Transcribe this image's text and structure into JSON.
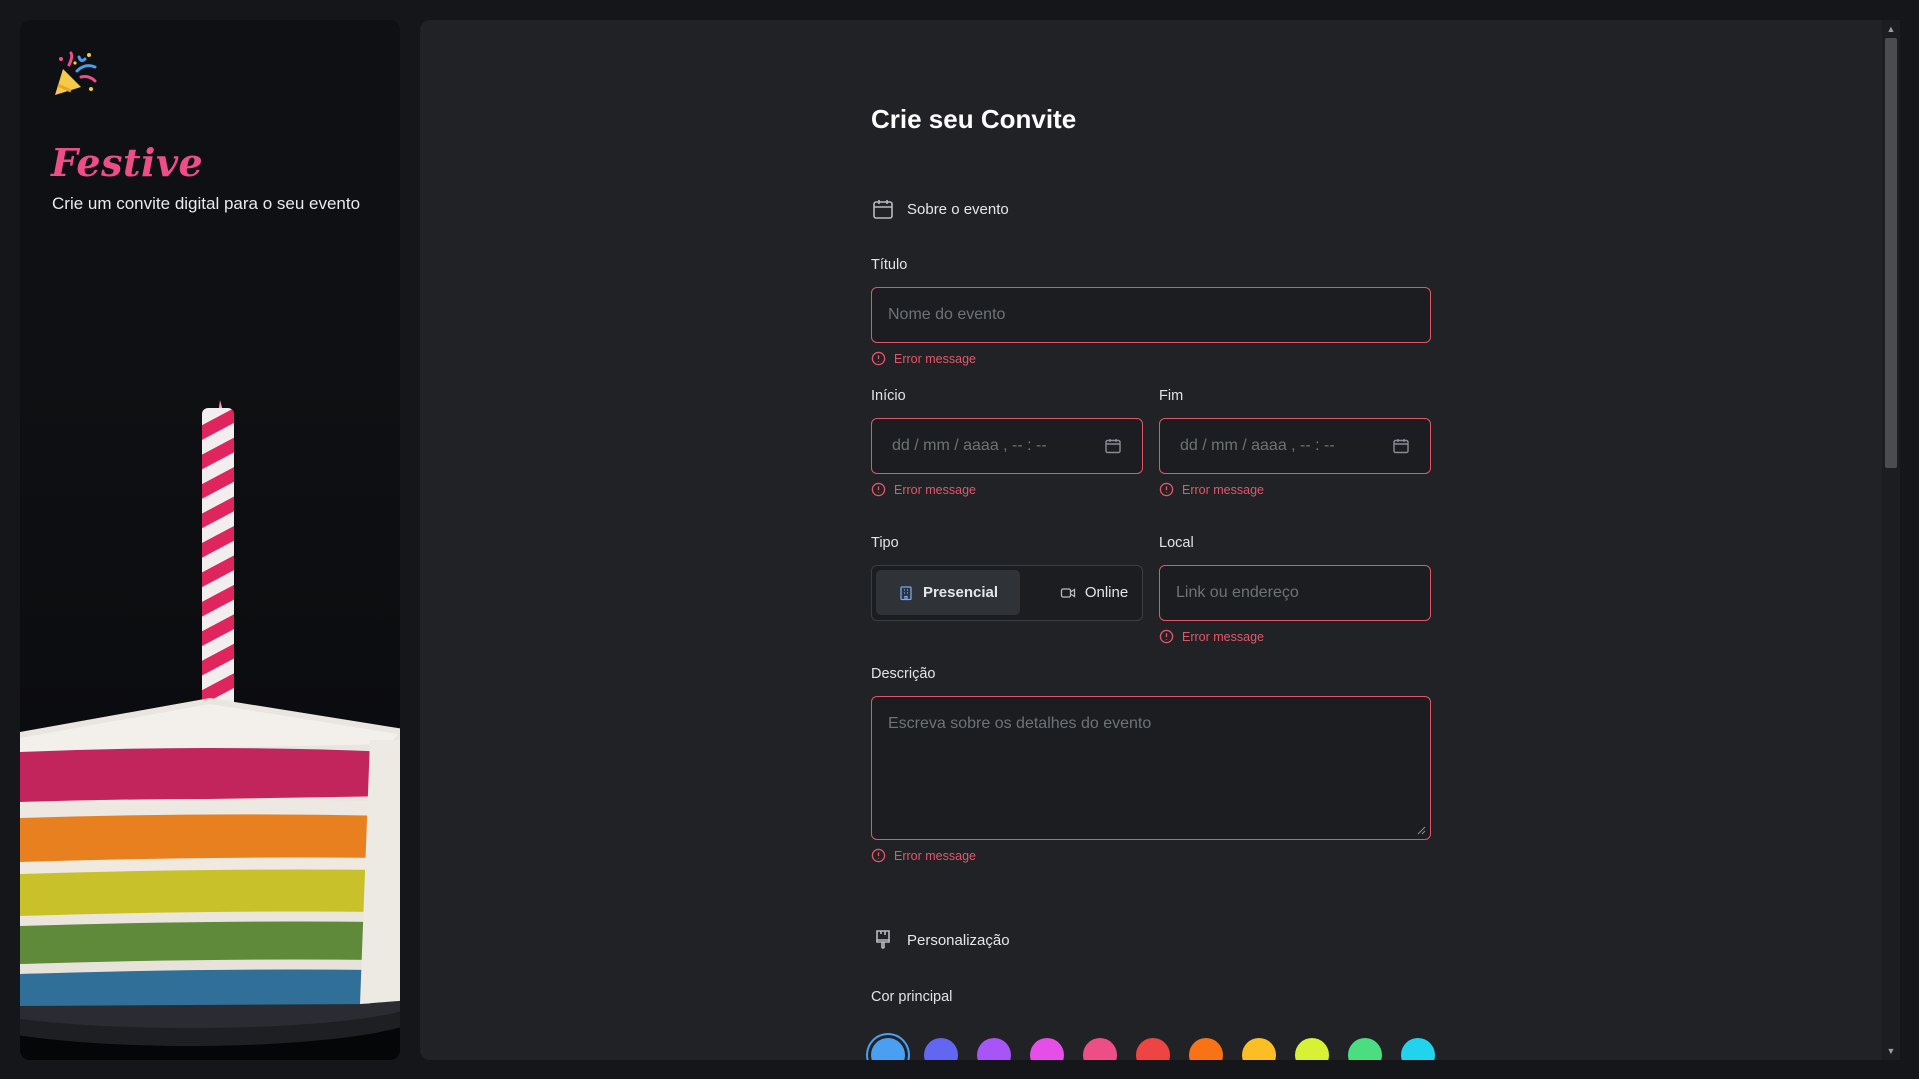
{
  "sidebar": {
    "brand": "Festive",
    "tagline": "Crie um convite digital para o seu evento",
    "logo_icon": "party-popper-icon"
  },
  "form": {
    "title": "Crie seu Convite",
    "section_event": {
      "label": "Sobre o evento",
      "icon": "calendar-icon"
    },
    "titulo": {
      "label": "Título",
      "placeholder": "Nome do evento",
      "error": "Error message"
    },
    "inicio": {
      "label": "Início",
      "placeholder": "dd / mm / aaaa ,  -- : --",
      "error": "Error message"
    },
    "fim": {
      "label": "Fim",
      "placeholder": "dd / mm / aaaa ,  -- : --",
      "error": "Error message"
    },
    "tipo": {
      "label": "Tipo",
      "options": [
        {
          "label": "Presencial",
          "icon": "building-icon",
          "selected": true
        },
        {
          "label": "Online",
          "icon": "video-icon",
          "selected": false
        }
      ]
    },
    "local": {
      "label": "Local",
      "placeholder": "Link ou endereço",
      "error": "Error message"
    },
    "descricao": {
      "label": "Descrição",
      "placeholder": "Escreva sobre os detalhes do evento",
      "error": "Error message"
    },
    "section_custom": {
      "label": "Personalização",
      "icon": "paintbrush-icon"
    },
    "cor_principal": {
      "label": "Cor principal",
      "selected_index": 0,
      "colors": [
        "#4a9ff0",
        "#6366f1",
        "#a855f7",
        "#e64ee8",
        "#ee4e86",
        "#ef4444",
        "#f97316",
        "#fbbf24",
        "#d9f135",
        "#4ade80",
        "#22d3ee"
      ]
    }
  },
  "colors": {
    "accent": "#ee4e86",
    "error": "#e4576a",
    "background": "#202226"
  }
}
